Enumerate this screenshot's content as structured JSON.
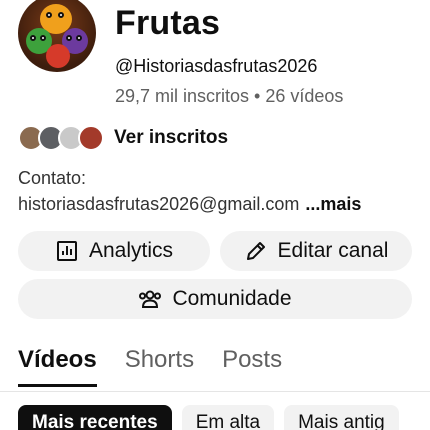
{
  "channel": {
    "name": "Frutas",
    "handle": "@Historiasdasfrutas2026",
    "stats": "29,7 mil inscritos • 26 vídeos",
    "subscribers_link": "Ver inscritos",
    "contact_label": "Contato:",
    "contact_email": "historiasdasfrutas2026@gmail.com",
    "more_label": "...mais"
  },
  "actions": {
    "analytics_label": "Analytics",
    "edit_label": "Editar canal",
    "community_label": "Comunidade"
  },
  "tabs": [
    {
      "label": "Vídeos",
      "active": true
    },
    {
      "label": "Shorts",
      "active": false
    },
    {
      "label": "Posts",
      "active": false
    }
  ],
  "filters": [
    {
      "label": "Mais recentes",
      "active": true
    },
    {
      "label": "Em alta",
      "active": false
    },
    {
      "label": "Mais antig",
      "active": false
    }
  ],
  "icons": {
    "analytics": "bar-chart-icon",
    "edit": "pencil-icon",
    "community": "people-icon"
  },
  "colors": {
    "text": "#0f0f0f",
    "secondary_text": "#606060",
    "button_bg": "#f2f2f2",
    "active_chip_bg": "#0f0f0f"
  }
}
